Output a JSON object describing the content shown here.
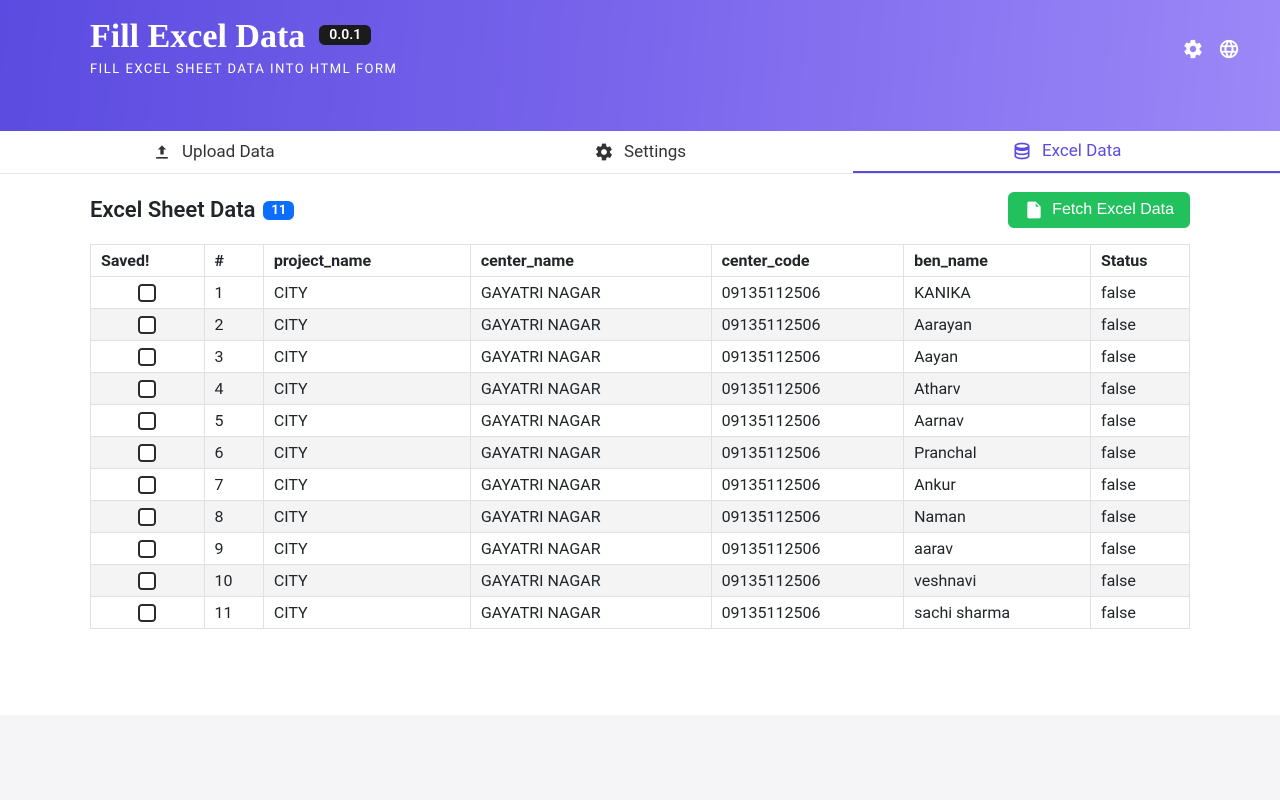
{
  "hero": {
    "title": "Fill Excel Data",
    "version": "0.0.1",
    "subtitle": "FILL EXCEL SHEET DATA INTO HTML FORM"
  },
  "tabs": {
    "upload": "Upload Data",
    "settings": "Settings",
    "excel": "Excel Data",
    "active_index": 2
  },
  "content": {
    "heading": "Excel Sheet Data",
    "count": "11",
    "fetch_label": "Fetch Excel Data"
  },
  "table": {
    "columns": [
      "Saved!",
      "#",
      "project_name",
      "center_name",
      "center_code",
      "ben_name",
      "Status"
    ],
    "rows": [
      {
        "idx": "1",
        "project_name": "CITY",
        "center_name": "GAYATRI NAGAR",
        "center_code": "09135112506",
        "ben_name": "KANIKA",
        "status": "false"
      },
      {
        "idx": "2",
        "project_name": "CITY",
        "center_name": "GAYATRI NAGAR",
        "center_code": "09135112506",
        "ben_name": "Aarayan",
        "status": "false"
      },
      {
        "idx": "3",
        "project_name": "CITY",
        "center_name": "GAYATRI NAGAR",
        "center_code": "09135112506",
        "ben_name": "Aayan",
        "status": "false"
      },
      {
        "idx": "4",
        "project_name": "CITY",
        "center_name": "GAYATRI NAGAR",
        "center_code": "09135112506",
        "ben_name": "Atharv",
        "status": "false"
      },
      {
        "idx": "5",
        "project_name": "CITY",
        "center_name": "GAYATRI NAGAR",
        "center_code": "09135112506",
        "ben_name": "Aarnav",
        "status": "false"
      },
      {
        "idx": "6",
        "project_name": "CITY",
        "center_name": "GAYATRI NAGAR",
        "center_code": "09135112506",
        "ben_name": "Pranchal",
        "status": "false"
      },
      {
        "idx": "7",
        "project_name": "CITY",
        "center_name": "GAYATRI NAGAR",
        "center_code": "09135112506",
        "ben_name": "Ankur",
        "status": "false"
      },
      {
        "idx": "8",
        "project_name": "CITY",
        "center_name": "GAYATRI NAGAR",
        "center_code": "09135112506",
        "ben_name": "Naman",
        "status": "false"
      },
      {
        "idx": "9",
        "project_name": "CITY",
        "center_name": "GAYATRI NAGAR",
        "center_code": "09135112506",
        "ben_name": "aarav",
        "status": "false"
      },
      {
        "idx": "10",
        "project_name": "CITY",
        "center_name": "GAYATRI NAGAR",
        "center_code": "09135112506",
        "ben_name": "veshnavi",
        "status": "false"
      },
      {
        "idx": "11",
        "project_name": "CITY",
        "center_name": "GAYATRI NAGAR",
        "center_code": "09135112506",
        "ben_name": "sachi sharma",
        "status": "false"
      }
    ]
  },
  "colors": {
    "hero_from": "#5b4be0",
    "hero_to": "#9c88f7",
    "accent": "#5b4be0",
    "badge_blue": "#0d6efd",
    "fetch_green": "#22c15e"
  }
}
